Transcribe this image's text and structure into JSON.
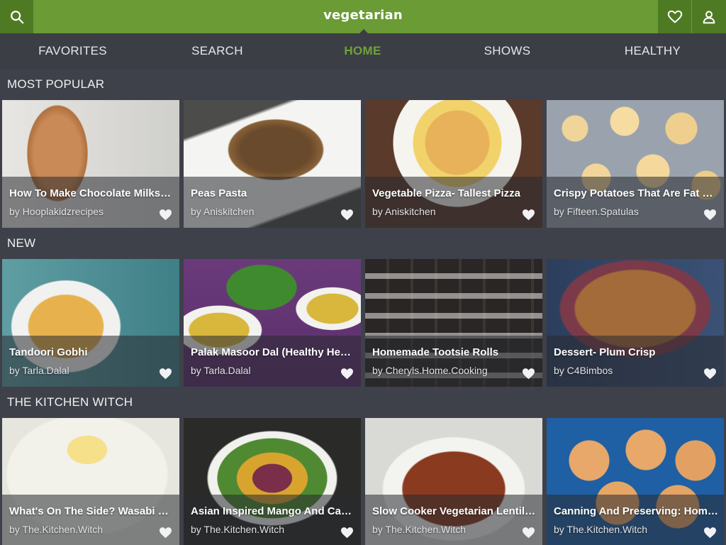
{
  "app": {
    "brand": "vegetarian",
    "accent_color": "#6a9b35",
    "icons": {
      "search": "search-icon",
      "favorites": "heart-icon",
      "account": "user-icon"
    }
  },
  "nav": {
    "tabs": [
      {
        "label": "FAVORITES",
        "active": false
      },
      {
        "label": "SEARCH",
        "active": false
      },
      {
        "label": "HOME",
        "active": true
      },
      {
        "label": "SHOWS",
        "active": false
      },
      {
        "label": "HEALTHY",
        "active": false
      }
    ]
  },
  "sections": [
    {
      "title": "MOST POPULAR",
      "cards": [
        {
          "title": "How To Make Chocolate Milkshake",
          "author": "by Hooplakidzrecipes"
        },
        {
          "title": "Peas Pasta",
          "author": "by Aniskitchen"
        },
        {
          "title": "Vegetable Pizza- Tallest Pizza",
          "author": "by Aniskitchen"
        },
        {
          "title": "Crispy Potatoes That Are Fat Free",
          "author": "by Fifteen.Spatulas"
        }
      ]
    },
    {
      "title": "NEW",
      "cards": [
        {
          "title": "Tandoori Gobhi",
          "author": "by Tarla.Dalal"
        },
        {
          "title": "Palak Masoor Dal (Healthy Heart)",
          "author": "by Tarla.Dalal"
        },
        {
          "title": "Homemade Tootsie Rolls",
          "author": "by Cheryls.Home.Cooking"
        },
        {
          "title": "Dessert- Plum Crisp",
          "author": "by C4Bimbos"
        }
      ]
    },
    {
      "title": "THE KITCHEN WITCH",
      "cards": [
        {
          "title": "What's On The Side? Wasabi Mashed Potatoes",
          "author": "by The.Kitchen.Witch"
        },
        {
          "title": "Asian Inspired Mango And Cabbage Salad",
          "author": "by The.Kitchen.Witch"
        },
        {
          "title": "Slow Cooker Vegetarian Lentil Soup",
          "author": "by The.Kitchen.Witch"
        },
        {
          "title": "Canning And Preserving: Homemade Crackers",
          "author": "by The.Kitchen.Witch"
        }
      ]
    }
  ]
}
